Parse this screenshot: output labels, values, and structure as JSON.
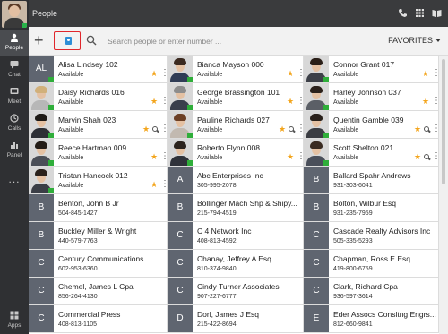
{
  "window": {
    "title": "People"
  },
  "sidebar": {
    "items": [
      {
        "label": "People",
        "icon": "people-icon",
        "active": true
      },
      {
        "label": "Chat",
        "icon": "chat-icon",
        "active": false
      },
      {
        "label": "Meet",
        "icon": "meet-icon",
        "active": false
      },
      {
        "label": "Calls",
        "icon": "calls-icon",
        "active": false
      },
      {
        "label": "Panel",
        "icon": "panel-icon",
        "active": false
      }
    ],
    "more": "...",
    "apps_label": "Apps"
  },
  "header_icons": [
    "phone-icon",
    "dialpad-icon",
    "book-icon"
  ],
  "toolbar": {
    "add": "+",
    "search_placeholder": "Search people or enter number ...",
    "favorites_label": "FAVORITES"
  },
  "colors": {
    "accent_red": "#e0262b",
    "presence_green": "#2fae3a",
    "star_orange": "#f3a51c",
    "tile_gray": "#5f6570"
  },
  "contacts": [
    {
      "name": "Alisa Lindsey 102",
      "sub": "Available",
      "tile": "AL",
      "photo": false,
      "star": true,
      "chat": false
    },
    {
      "name": "Bianca Mayson 000",
      "sub": "Available",
      "photo": true,
      "hair": "#3b2a20",
      "shirt": "#2f3c55",
      "star": true,
      "chat": false
    },
    {
      "name": "Connor Grant 017",
      "sub": "Available",
      "photo": true,
      "hair": "#2a1f18",
      "shirt": "#3d4048",
      "star": true,
      "chat": false
    },
    {
      "name": "Daisy Richards 016",
      "sub": "Available",
      "photo": true,
      "hair": "#d1b07a",
      "shirt": "#b7b7b7",
      "star": true,
      "chat": false
    },
    {
      "name": "George Brassington 101",
      "sub": "Available",
      "photo": true,
      "hair": "#8d8d8d",
      "shirt": "#3a3f4c",
      "star": true,
      "chat": false
    },
    {
      "name": "Harley Johnson 037",
      "sub": "Available",
      "photo": true,
      "hair": "#2b211b",
      "shirt": "#5b5f66",
      "star": true,
      "chat": false
    },
    {
      "name": "Marvin Shah 023",
      "sub": "Available",
      "photo": true,
      "hair": "#1e1a16",
      "shirt": "#2d2f35",
      "star": true,
      "chat": true
    },
    {
      "name": "Pauline Richards 027",
      "sub": "Available",
      "photo": true,
      "hair": "#6b3f25",
      "shirt": "#c2b9b0",
      "star": true,
      "chat": true
    },
    {
      "name": "Quentin Gamble 039",
      "sub": "Available",
      "photo": true,
      "hair": "#2a211b",
      "shirt": "#3a3c42",
      "star": true,
      "chat": true
    },
    {
      "name": "Reece Hartman 009",
      "sub": "Available",
      "photo": true,
      "hair": "#231c16",
      "shirt": "#4a4e57",
      "star": true,
      "chat": false
    },
    {
      "name": "Roberto Flynn 008",
      "sub": "Available",
      "photo": true,
      "hair": "#2c241e",
      "shirt": "#2f323a",
      "star": true,
      "chat": false
    },
    {
      "name": "Scott Shelton 021",
      "sub": "Available",
      "photo": true,
      "hair": "#3a2b22",
      "shirt": "#4a4f5a",
      "star": true,
      "chat": true
    },
    {
      "name": "Tristan Hancock 012",
      "sub": "Available",
      "photo": true,
      "hair": "#2a211b",
      "shirt": "#3b3e46",
      "star": true,
      "chat": false
    },
    {
      "name": "Abc Enterprises Inc",
      "sub": "305-995-2078",
      "tile": "A",
      "photo": false,
      "star": false,
      "chat": false
    },
    {
      "name": "Ballard Spahr Andrews",
      "sub": "931-303-6041",
      "tile": "B",
      "photo": false,
      "star": false,
      "chat": false
    },
    {
      "name": "Benton, John B Jr",
      "sub": "504-845-1427",
      "tile": "B",
      "photo": false,
      "star": false,
      "chat": false
    },
    {
      "name": "Bollinger Mach Shp & Shipy...",
      "sub": "215-794-4519",
      "tile": "B",
      "photo": false,
      "star": false,
      "chat": false
    },
    {
      "name": "Bolton, Wilbur Esq",
      "sub": "931-235-7959",
      "tile": "B",
      "photo": false,
      "star": false,
      "chat": false
    },
    {
      "name": "Buckley Miller & Wright",
      "sub": "440-579-7763",
      "tile": "B",
      "photo": false,
      "star": false,
      "chat": false
    },
    {
      "name": "C 4 Network Inc",
      "sub": "408-813-4592",
      "tile": "C",
      "photo": false,
      "star": false,
      "chat": false
    },
    {
      "name": "Cascade Realty Advisors Inc",
      "sub": "505-335-5293",
      "tile": "C",
      "photo": false,
      "star": false,
      "chat": false
    },
    {
      "name": "Century Communications",
      "sub": "602-953-6360",
      "tile": "C",
      "photo": false,
      "star": false,
      "chat": false
    },
    {
      "name": "Chanay, Jeffrey A Esq",
      "sub": "810-374-9840",
      "tile": "C",
      "photo": false,
      "star": false,
      "chat": false
    },
    {
      "name": "Chapman, Ross E Esq",
      "sub": "419-800-6759",
      "tile": "C",
      "photo": false,
      "star": false,
      "chat": false
    },
    {
      "name": "Chemel, James L Cpa",
      "sub": "856-264-4130",
      "tile": "C",
      "photo": false,
      "star": false,
      "chat": false
    },
    {
      "name": "Cindy Turner Associates",
      "sub": "907-227-6777",
      "tile": "C",
      "photo": false,
      "star": false,
      "chat": false
    },
    {
      "name": "Clark, Richard Cpa",
      "sub": "936-597-3614",
      "tile": "C",
      "photo": false,
      "star": false,
      "chat": false
    },
    {
      "name": "Commercial Press",
      "sub": "408-813-1105",
      "tile": "C",
      "photo": false,
      "star": false,
      "chat": false
    },
    {
      "name": "Dorl, James J Esq",
      "sub": "215-422-8694",
      "tile": "D",
      "photo": false,
      "star": false,
      "chat": false
    },
    {
      "name": "Eder Assocs Consltng Engrs...",
      "sub": "812-660-9841",
      "tile": "E",
      "photo": false,
      "star": false,
      "chat": false
    }
  ]
}
